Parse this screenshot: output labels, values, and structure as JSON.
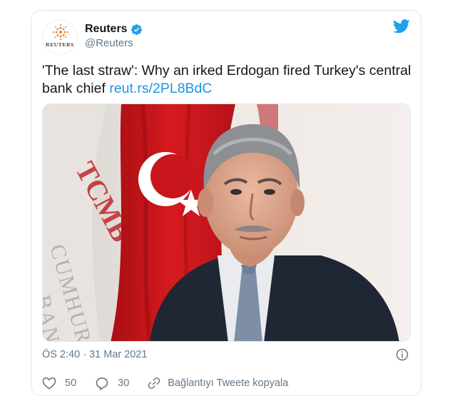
{
  "author": {
    "display_name": "Reuters",
    "handle": "@Reuters",
    "avatar_text": "REUTERS",
    "verified": true
  },
  "tweet": {
    "text": "'The last straw': Why an irked Erdogan fired Turkey's central bank chief",
    "link_text": "reut.rs/2PL8BdC",
    "timestamp": "ÖS 2:40 · 31 Mar 2021"
  },
  "actions": {
    "likes": "50",
    "replies": "30",
    "copy_link_label": "Bağlantıyı Tweete kopyala"
  },
  "media": {
    "image_text": "TCMB CUMHURİYET BANKASI"
  },
  "colors": {
    "accent": "#1da1f2",
    "link": "#1b95e0",
    "text": "#14171a",
    "muted": "#657786",
    "border": "#e1e8ed",
    "flag_red": "#e30a17"
  }
}
